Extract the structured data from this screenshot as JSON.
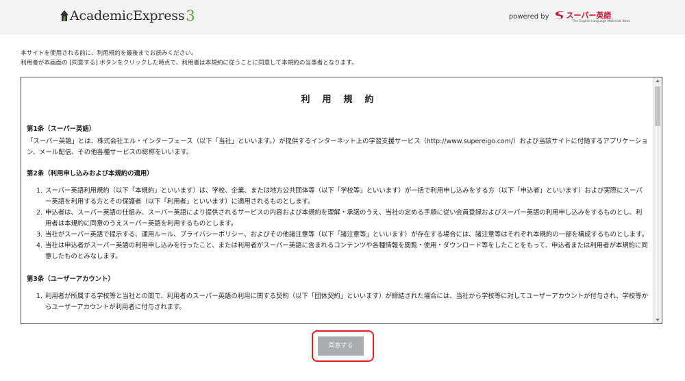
{
  "header": {
    "logo_text": "AcademicExpress",
    "logo_num": "3",
    "powered_label": "powered by",
    "brand_name": "スーパー英語",
    "brand_sub": "The English Language Materials Bank"
  },
  "intro": {
    "line1": "本サイトを使用される前に、利用規約を最後までお読みください。",
    "line2": "利用者が本画面の [同意する] ボタンをクリックした時点で、利用者は本規約に従うことに同意して本規約の当事者となります。"
  },
  "terms": {
    "title": "利用規約",
    "article1": {
      "title": "第1条（スーパー英語）",
      "body": "「スーパー英語」とは、株式会社エル・インターフェース（以下「当社」といいます。）が提供するインターネット上の学習支援サービス（http://www.supereigo.com/）および当該サイトに付随するアプリケーション、メール配信、その他各種サービスの総称をいいます。"
    },
    "article2": {
      "title": "第2条（利用申し込みおよび本規約の適用）",
      "items": [
        {
          "num": "1.",
          "text": "スーパー英語利用規約（以下「本規約」といいます）は、学校、企業、または地方公共団体等（以下「学校等」といいます）が一括で利用申し込みをする方（以下「申込者」といいます）および実際にスーパー英語を利用する方とその保護者（以下「利用者」といいます）に適用されるものとします。"
        },
        {
          "num": "2.",
          "text": "申込者は、スーパー英語の仕組み、スーパー英語により提供されるサービスの内容および本規約を理解・承諾のうえ、当社の定める手順に従い会員登録およびスーパー英語の利用申し込みをするものとし、利用者は本規約に同意のうえスーパー英語を利用するものとします。"
        },
        {
          "num": "3.",
          "text": "当社がスーパー英語で提示する、運用ルール、プライバシーポリシー、およびその他諸注意等（以下「諸注意等」といいます）が存在する場合には、諸注意等はそれぞれ本規約の一部を構成するものとします。"
        },
        {
          "num": "4.",
          "text": "当社は申込者がスーパー英語の利用申し込みを行ったこと、または利用者がスーパー英語に含まれるコンテンツや各種情報を閲覧・使用・ダウンロード等をしたことをもって、申込者または利用者が本規約に同意したものとみなします。"
        }
      ]
    },
    "article3": {
      "title": "第3条（ユーザーアカウント）",
      "items": [
        {
          "num": "1.",
          "text": "利用者が所属する学校等と当社との間で、利用者のスーパー英語の利用に関する契約（以下「団体契約」といいます）が締結された場合には、当社から学校等に対してユーザーアカウントが付与され、学校等からユーザーアカウントが利用者に付与されます。"
        }
      ]
    }
  },
  "agree_button": {
    "label": "同意する"
  },
  "colors": {
    "highlight": "#e02020",
    "button_disabled": "#a8adb2",
    "logo_accent": "#5aa03a",
    "brand_red": "#c8102e"
  }
}
